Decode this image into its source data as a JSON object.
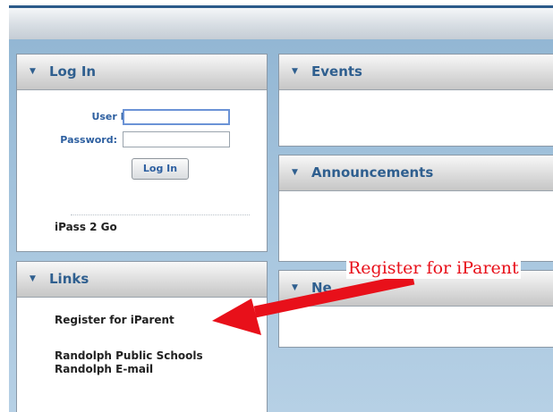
{
  "login_panel": {
    "title": "Log In",
    "user_id_label": "User Id:",
    "user_id_value": "",
    "password_label": "Password:",
    "password_value": "",
    "login_button": "Log In",
    "ipass_link": "iPass 2 Go"
  },
  "links_panel": {
    "title": "Links",
    "items": [
      "Register for iParent",
      "Randolph Public Schools",
      "Randolph E-mail"
    ]
  },
  "events_panel": {
    "title": "Events"
  },
  "announcements_panel": {
    "title": "Announcements"
  },
  "news_panel": {
    "title": "Ne"
  },
  "annotation": {
    "text": "Register for iParent",
    "color": "#e8101a"
  },
  "colors": {
    "header_text": "#2f5f8f",
    "label_text": "#2d5fa0",
    "accent_border": "#2b5a8a",
    "page_background": "#a9c7df"
  },
  "icons": {
    "panel_toggle": "chevron-down-icon",
    "annotation_arrow": "arrow-icon"
  }
}
